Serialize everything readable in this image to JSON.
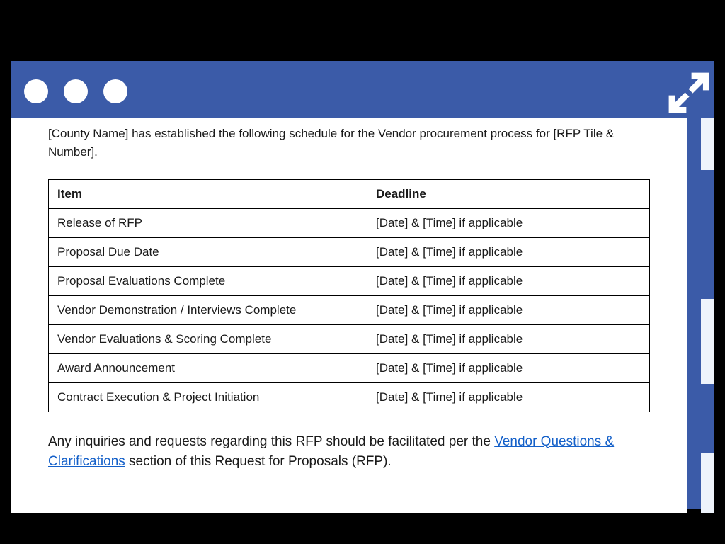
{
  "doc": {
    "intro": "[County Name] has established the following schedule for the Vendor procurement process for [RFP Tile & Number].",
    "table": {
      "headers": {
        "item": "Item",
        "deadline": "Deadline"
      },
      "rows": [
        {
          "item": "Release of RFP",
          "deadline": "[Date] & [Time] if applicable"
        },
        {
          "item": "Proposal Due Date",
          "deadline": "[Date] & [Time] if applicable"
        },
        {
          "item": "Proposal Evaluations Complete",
          "deadline": "[Date] & [Time] if applicable"
        },
        {
          "item": "Vendor Demonstration / Interviews Complete",
          "deadline": "[Date] & [Time] if applicable"
        },
        {
          "item": "Vendor Evaluations & Scoring Complete",
          "deadline": "[Date] & [Time] if applicable"
        },
        {
          "item": "Award Announcement",
          "deadline": "[Date] & [Time] if applicable"
        },
        {
          "item": "Contract Execution & Project Initiation",
          "deadline": "[Date] & [Time] if applicable"
        }
      ]
    },
    "outro_pre": "Any inquiries and requests regarding this RFP should be facilitated per the ",
    "outro_link": "Vendor Questions & Clarifications",
    "outro_post": " section of this Request for Proposals (RFP)."
  }
}
